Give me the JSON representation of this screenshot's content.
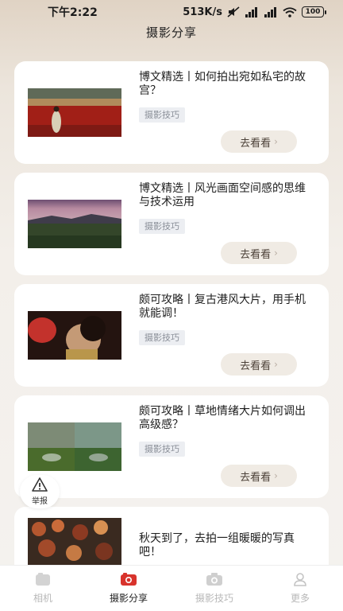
{
  "status_bar": {
    "time": "下午2:22",
    "network_speed": "513K/s",
    "battery": "100"
  },
  "header": {
    "title": "摄影分享"
  },
  "articles": [
    {
      "title": "博文精选丨如何拍出宛如私宅的故宫？",
      "tag": "摄影技巧",
      "button": "去看看"
    },
    {
      "title": "博文精选丨风光画面空间感的思维与技术运用",
      "tag": "摄影技巧",
      "button": "去看看"
    },
    {
      "title": "颇可攻略丨复古港风大片，用手机就能调！",
      "tag": "摄影技巧",
      "button": "去看看"
    },
    {
      "title": "颇可攻略丨草地情绪大片如何调出高级感？",
      "tag": "摄影技巧",
      "button": "去看看"
    },
    {
      "title": "秋天到了，去拍一组暖暖的写真吧！"
    }
  ],
  "report": {
    "label": "举报"
  },
  "tab_bar": {
    "items": [
      {
        "label": "相机",
        "icon": "camera-app-icon",
        "active": false
      },
      {
        "label": "摄影分享",
        "icon": "share-icon",
        "active": true
      },
      {
        "label": "摄影技巧",
        "icon": "camera-icon",
        "active": false
      },
      {
        "label": "更多",
        "icon": "user-icon",
        "active": false
      }
    ]
  },
  "colors": {
    "button_bg": "#f0ebe4",
    "tag_bg": "#eceef2",
    "active_tab": "#222222",
    "inactive_tab": "#b8b8b8",
    "share_icon": "#d8332c"
  }
}
